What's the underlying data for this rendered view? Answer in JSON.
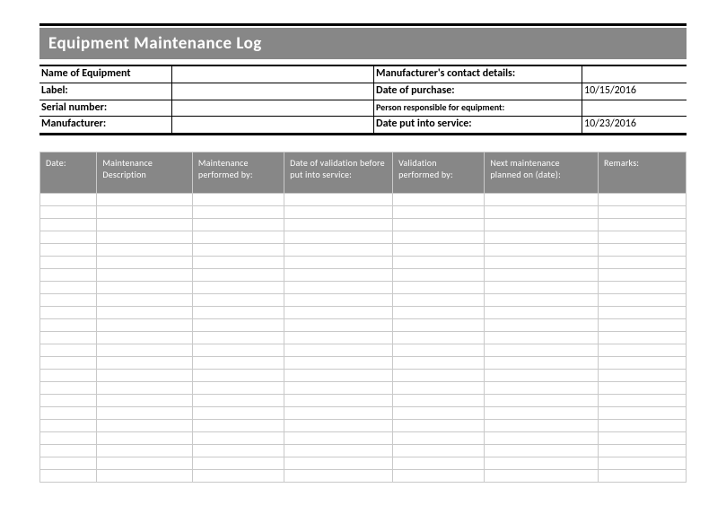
{
  "title": "Equipment Maintenance Log",
  "info": {
    "name_of_equipment_label": "Name of Equipment",
    "name_of_equipment_value": "",
    "manufacturer_contact_label": "Manufacturer's contact details:",
    "manufacturer_contact_value": "",
    "label_label": "Label:",
    "label_value": "",
    "date_of_purchase_label": "Date of purchase:",
    "date_of_purchase_value": "10/15/2016",
    "serial_number_label": "Serial number:",
    "serial_number_value": "",
    "person_responsible_label": "Person responsible for equipment:",
    "person_responsible_value": "",
    "manufacturer_label": "Manufacturer:",
    "manufacturer_value": "",
    "date_put_into_service_label": "Date put into service:",
    "date_put_into_service_value": "10/23/2016"
  },
  "columns": [
    "Date:",
    "Maintenance Description",
    "Maintenance performed by:",
    "Date of validation before put into service:",
    "Validation performed by:",
    "Next maintenance planned on (date):",
    "Remarks:"
  ],
  "rows_count": 23
}
